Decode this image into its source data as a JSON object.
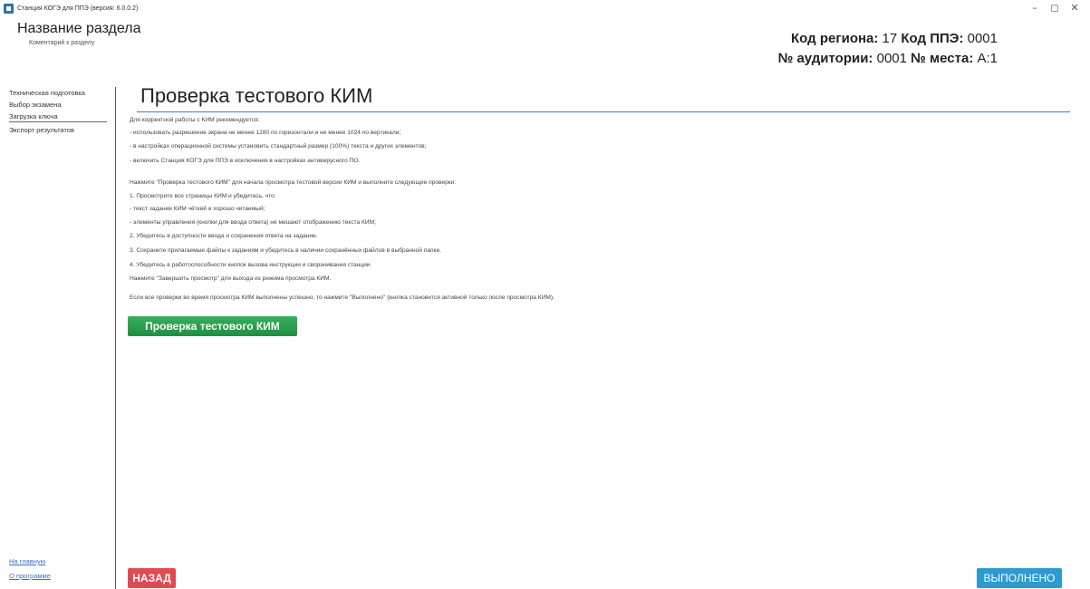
{
  "window": {
    "title": "Станция КОГЭ для ППЭ (версия: 6.0.0.2)",
    "controls": {
      "minimize": "–",
      "maximize": "◻",
      "close": "✕"
    }
  },
  "header": {
    "section_title": "Название раздела",
    "section_comment": "Коментарий к разделу",
    "region_label": "Код региона:",
    "region_value": "17",
    "ppe_label": "Код ППЭ:",
    "ppe_value": "0001",
    "auditorium_label": "№ аудитории:",
    "auditorium_value": "0001",
    "place_label": "№ места:",
    "place_value": "А:1"
  },
  "sidebar": {
    "items": [
      {
        "label": "Техническая подготовка"
      },
      {
        "label": "Выбор экзамена"
      },
      {
        "label": "Загрузка ключа",
        "active": true
      },
      {
        "label": "Экспорт результатов"
      }
    ],
    "footer_links": [
      {
        "label": "На главную"
      },
      {
        "label": "О программе"
      }
    ]
  },
  "main": {
    "title": "Проверка тестового КИМ",
    "instructions": [
      "Для корректной работы с КИМ рекомендуется:",
      "- использовать разрешение экрана не менее 1280 по горизонтали и не менее 1024 по вертикали;",
      "- в настройках операционной системы установить стандартный размер (100%) текста и других элементов;",
      "- включить Станция КОГЭ для ППЭ в исключения в настройках антивирусного ПО.",
      "Нажмите \"Проверка тестового КИМ\" для начала просмотра тестовой версии КИМ и выполните следующие проверки:",
      "1. Просмотрите все страницы КИМ и убедитесь, что:",
      "- текст задания КИМ чёткий и хорошо читаемый;",
      "- элементы управления (кнопки для ввода ответа) не мешают отображению текста КИМ;",
      "2. Убедитесь в доступности ввода и сохранения ответа на задание.",
      "3. Сохраните прилагаемые файлы к заданиям и убедитесь в наличии сохранённых файлов в выбранной папке.",
      "4. Убедитесь в работоспособности кнопок вызова инструкции и сворачивания станции.",
      "Нажмите \"Завершить просмотр\" для выхода из режима просмотра КИМ.",
      "Если все проверки во время просмотра КИМ выполнены успешно, то нажмите \"Выполнено\" (кнопка становится активной только после просмотра КИМ)."
    ],
    "check_button": "Проверка тестового КИМ",
    "back_button": "НАЗАД",
    "done_button": "ВЫПОЛНЕНО"
  },
  "colors": {
    "title_rule": "#3a84c0",
    "check_button": "#27a04a",
    "back_button": "#e04a52",
    "done_button": "#2d9ad0",
    "link": "#3a6fc4"
  }
}
